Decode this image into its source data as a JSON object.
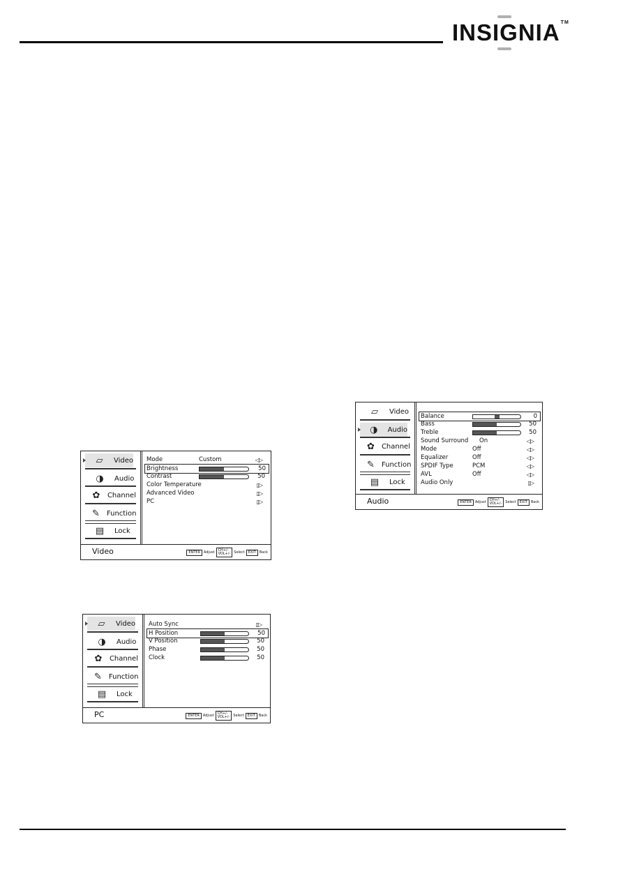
{
  "brand": {
    "logo_text": "INSIGNIA",
    "trademark": "TM"
  },
  "screens": [
    {
      "id": "video",
      "footer_title": "Video",
      "active_menu": 0,
      "menu": [
        {
          "label": "Video",
          "icon": "video-icon"
        },
        {
          "label": "Audio",
          "icon": "audio-icon"
        },
        {
          "label": "Channel",
          "icon": "channel-icon"
        },
        {
          "label": "Function",
          "icon": "function-icon"
        },
        {
          "label": "Lock",
          "icon": "lock-icon"
        }
      ],
      "rows": [
        {
          "name": "Mode",
          "value": "Custom",
          "control": "lr-arrows"
        },
        {
          "name": "Brightness",
          "slider": 50,
          "value": "50",
          "highlighted": true
        },
        {
          "name": "Contrast",
          "slider": 50,
          "value": "50"
        },
        {
          "name": "Color Temperature",
          "control": "enter-arrow"
        },
        {
          "name": "Advanced Video",
          "control": "enter-arrow"
        },
        {
          "name": "PC",
          "control": "enter-arrow"
        }
      ]
    },
    {
      "id": "pc",
      "footer_title": "PC",
      "active_menu": 0,
      "menu": [
        {
          "label": "Video",
          "icon": "video-icon"
        },
        {
          "label": "Audio",
          "icon": "audio-icon"
        },
        {
          "label": "Channel",
          "icon": "channel-icon"
        },
        {
          "label": "Function",
          "icon": "function-icon"
        },
        {
          "label": "Lock",
          "icon": "lock-icon"
        }
      ],
      "rows": [
        {
          "name": "Auto Sync",
          "control": "enter-arrow"
        },
        {
          "name": "H Position",
          "slider": 50,
          "value": "50",
          "highlighted": true
        },
        {
          "name": "V Position",
          "slider": 50,
          "value": "50"
        },
        {
          "name": "Phase",
          "slider": 50,
          "value": "50"
        },
        {
          "name": "Clock",
          "slider": 50,
          "value": "50"
        }
      ]
    },
    {
      "id": "audio",
      "footer_title": "Audio",
      "active_menu": 1,
      "menu": [
        {
          "label": "Video",
          "icon": "video-icon"
        },
        {
          "label": "Audio",
          "icon": "audio-icon"
        },
        {
          "label": "Channel",
          "icon": "channel-icon"
        },
        {
          "label": "Function",
          "icon": "function-icon"
        },
        {
          "label": "Lock",
          "icon": "lock-icon"
        }
      ],
      "rows": [
        {
          "name": "Balance",
          "balance": 0,
          "value": "0",
          "highlighted": true
        },
        {
          "name": "Bass",
          "slider": 50,
          "value": "50"
        },
        {
          "name": "Treble",
          "slider": 50,
          "value": "50"
        },
        {
          "name": "Sound Surround",
          "value": "On",
          "control": "lr-arrows"
        },
        {
          "name": "Mode",
          "value": "Off",
          "control": "lr-arrows"
        },
        {
          "name": "Equalizer",
          "value": "Off",
          "control": "lr-arrows"
        },
        {
          "name": "SPDIF Type",
          "value": "PCM",
          "control": "lr-arrows"
        },
        {
          "name": "AVL",
          "value": "Off",
          "control": "lr-arrows"
        },
        {
          "name": "Audio Only",
          "control": "enter-arrow"
        }
      ]
    }
  ],
  "footer_hints": {
    "enter_key": "ENTER",
    "adjust": "Adjust",
    "ch_vol_key_line1": "CH+/-",
    "ch_vol_key_line2": "VOL+/-",
    "select": "Select",
    "exit_key": "EXIT",
    "back": "Back"
  },
  "glyphs": {
    "lr-arrows": "◁▷",
    "enter-arrow": "▯▷",
    "video-icon": "▱",
    "audio-icon": "◑",
    "channel-icon": "✿",
    "function-icon": "✎",
    "lock-icon": "▤"
  }
}
